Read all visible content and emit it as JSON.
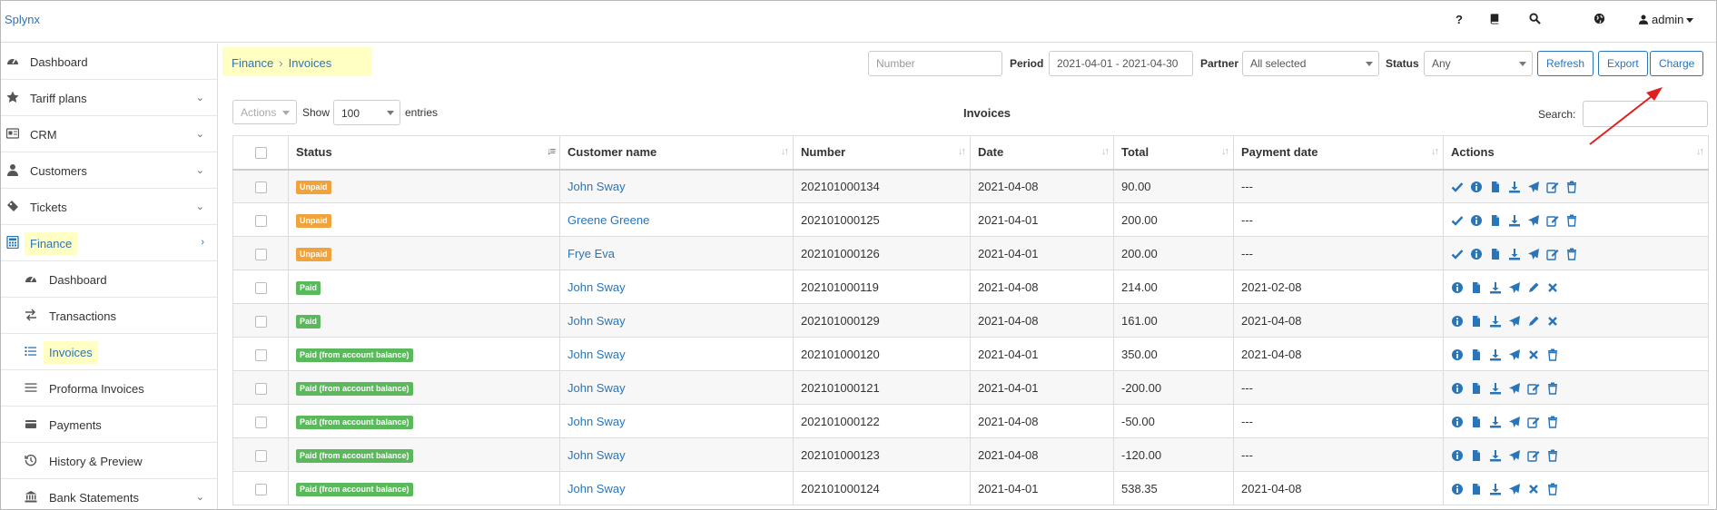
{
  "app": {
    "brand": "Splynx",
    "user": "admin"
  },
  "sidebar": {
    "items": [
      {
        "label": "Dashboard",
        "icon": "dashboard-icon"
      },
      {
        "label": "Tariff plans",
        "icon": "star-icon"
      },
      {
        "label": "CRM",
        "icon": "crm-icon"
      },
      {
        "label": "Customers",
        "icon": "user-icon"
      },
      {
        "label": "Tickets",
        "icon": "ticket-icon"
      },
      {
        "label": "Finance",
        "icon": "calculator-icon"
      }
    ],
    "finance_sub": [
      {
        "label": "Dashboard",
        "icon": "dashboard-icon"
      },
      {
        "label": "Transactions",
        "icon": "transfer-icon"
      },
      {
        "label": "Invoices",
        "icon": "list-icon"
      },
      {
        "label": "Proforma Invoices",
        "icon": "list-icon"
      },
      {
        "label": "Payments",
        "icon": "payment-icon"
      },
      {
        "label": "History & Preview",
        "icon": "history-icon"
      },
      {
        "label": "Bank Statements",
        "icon": "bank-icon"
      }
    ]
  },
  "breadcrumb": {
    "parent": "Finance",
    "current": "Invoices"
  },
  "filters": {
    "number_placeholder": "Number",
    "period_label": "Period",
    "period_value": "2021-04-01 - 2021-04-30",
    "partner_label": "Partner",
    "partner_value": "All selected",
    "status_label": "Status",
    "status_value": "Any",
    "refresh": "Refresh",
    "export": "Export",
    "charge": "Charge"
  },
  "table_controls": {
    "actions": "Actions",
    "show": "Show",
    "show_value": "100",
    "entries": "entries",
    "title": "Invoices",
    "search": "Search:"
  },
  "table": {
    "columns": [
      "Status",
      "Customer name",
      "Number",
      "Date",
      "Total",
      "Payment date",
      "Actions"
    ],
    "rows": [
      {
        "status": "Unpaid",
        "type": "unpaid",
        "customer": "John Sway",
        "number": "202101000134",
        "date": "2021-04-08",
        "total": "90.00",
        "payment_date": "---",
        "actions": [
          "check",
          "info",
          "file",
          "download",
          "send",
          "edit",
          "trash"
        ]
      },
      {
        "status": "Unpaid",
        "type": "unpaid",
        "customer": "Greene Greene",
        "number": "202101000125",
        "date": "2021-04-01",
        "total": "200.00",
        "payment_date": "---",
        "actions": [
          "check",
          "info",
          "file",
          "download",
          "send",
          "edit",
          "trash"
        ]
      },
      {
        "status": "Unpaid",
        "type": "unpaid",
        "customer": "Frye Eva",
        "number": "202101000126",
        "date": "2021-04-01",
        "total": "200.00",
        "payment_date": "---",
        "actions": [
          "check",
          "info",
          "file",
          "download",
          "send",
          "edit",
          "trash"
        ]
      },
      {
        "status": "Paid",
        "type": "paid",
        "customer": "John Sway",
        "number": "202101000119",
        "date": "2021-04-08",
        "total": "214.00",
        "payment_date": "2021-02-08",
        "actions": [
          "info",
          "file",
          "download",
          "send",
          "pencil",
          "close"
        ]
      },
      {
        "status": "Paid",
        "type": "paid",
        "customer": "John Sway",
        "number": "202101000129",
        "date": "2021-04-08",
        "total": "161.00",
        "payment_date": "2021-04-08",
        "actions": [
          "info",
          "file",
          "download",
          "send",
          "pencil",
          "close"
        ]
      },
      {
        "status": "Paid (from account balance)",
        "type": "paid",
        "customer": "John Sway",
        "number": "202101000120",
        "date": "2021-04-01",
        "total": "350.00",
        "payment_date": "2021-04-08",
        "actions": [
          "info",
          "file",
          "download",
          "send",
          "close",
          "trash"
        ]
      },
      {
        "status": "Paid (from account balance)",
        "type": "paid",
        "customer": "John Sway",
        "number": "202101000121",
        "date": "2021-04-01",
        "total": "-200.00",
        "payment_date": "---",
        "actions": [
          "info",
          "file",
          "download",
          "send",
          "edit",
          "trash"
        ]
      },
      {
        "status": "Paid (from account balance)",
        "type": "paid",
        "customer": "John Sway",
        "number": "202101000122",
        "date": "2021-04-08",
        "total": "-50.00",
        "payment_date": "---",
        "actions": [
          "info",
          "file",
          "download",
          "send",
          "edit",
          "trash"
        ]
      },
      {
        "status": "Paid (from account balance)",
        "type": "paid",
        "customer": "John Sway",
        "number": "202101000123",
        "date": "2021-04-08",
        "total": "-120.00",
        "payment_date": "---",
        "actions": [
          "info",
          "file",
          "download",
          "send",
          "edit",
          "trash"
        ]
      },
      {
        "status": "Paid (from account balance)",
        "type": "paid",
        "customer": "John Sway",
        "number": "202101000124",
        "date": "2021-04-01",
        "total": "538.35",
        "payment_date": "2021-04-08",
        "actions": [
          "info",
          "file",
          "download",
          "send",
          "close",
          "trash"
        ]
      }
    ]
  },
  "colors": {
    "accent": "#2a74b8",
    "unpaid": "#f0a33c",
    "paid": "#5cb85c",
    "highlight": "#ffffc4",
    "annotation_arrow": "#e02020"
  }
}
